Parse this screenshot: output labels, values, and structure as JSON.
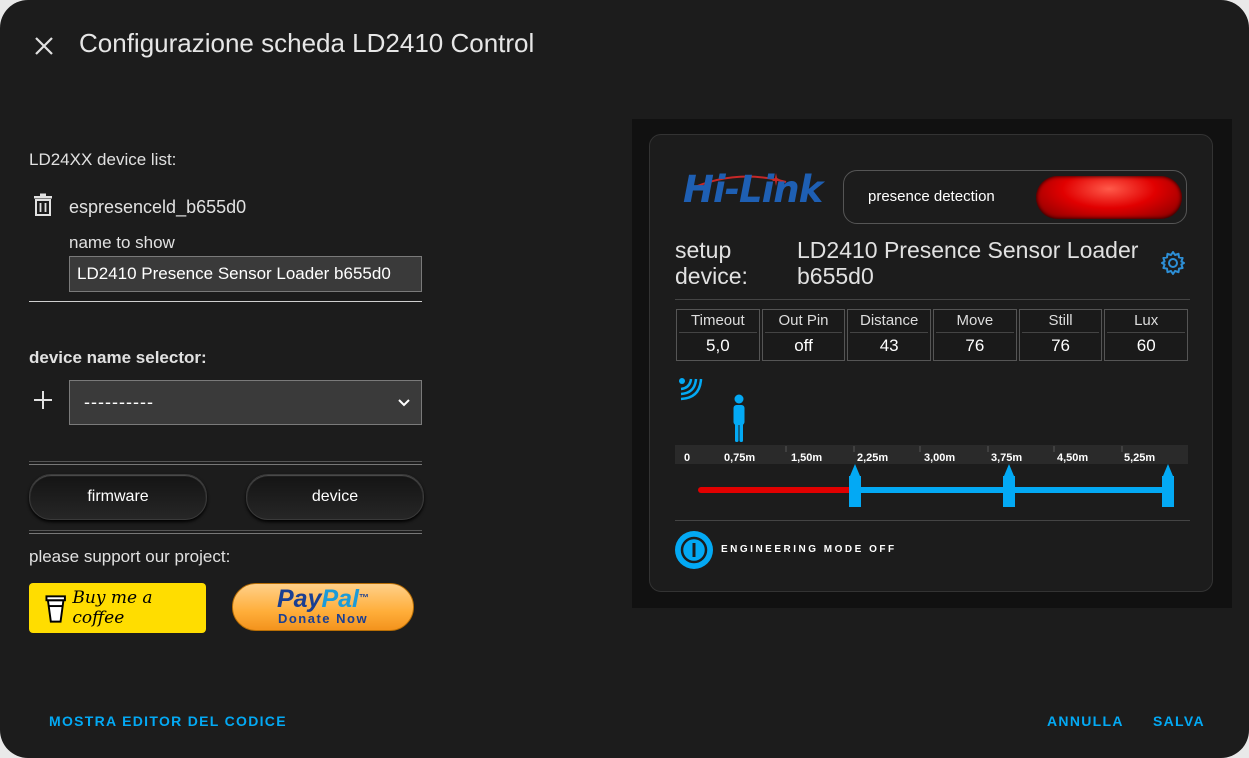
{
  "dialog": {
    "title": "Configurazione scheda LD2410 Control"
  },
  "form": {
    "device_list_label": "LD24XX device list:",
    "device_entity": "espresenceld_b655d0",
    "name_to_show_label": "name to show",
    "name_to_show_value": "LD2410 Presence Sensor Loader b655d0",
    "device_name_selector_label": "device name selector:",
    "selector_value": "----------",
    "firmware_label": "firmware",
    "device_label": "device",
    "support_label": "please support our project:",
    "bmc_label": "Buy me a coffee",
    "paypal_line1a": "Pay",
    "paypal_line1b": "Pal",
    "paypal_tm": "™",
    "paypal_line2": "Donate Now"
  },
  "preview": {
    "brand": "Hi-Link",
    "presence_label": "presence detection",
    "setup_label_1": "setup",
    "setup_label_2": "device:",
    "device_name": "LD2410 Presence Sensor Loader b655d0",
    "stats": [
      {
        "label": "Timeout",
        "value": "5,0"
      },
      {
        "label": "Out Pin",
        "value": "off"
      },
      {
        "label": "Distance",
        "value": "43"
      },
      {
        "label": "Move",
        "value": "76"
      },
      {
        "label": "Still",
        "value": "76"
      },
      {
        "label": "Lux",
        "value": "60"
      }
    ],
    "ruler_ticks": [
      "0",
      "0,75m",
      "1,50m",
      "2,25m",
      "3,00m",
      "3,75m",
      "4,50m",
      "5,25m"
    ],
    "engineering_label": "ENGINEERING MODE OFF",
    "colors": {
      "accent": "#03a9f4",
      "alert": "#e10000"
    }
  },
  "footer": {
    "code_editor": "MOSTRA EDITOR DEL CODICE",
    "cancel": "ANNULLA",
    "save": "SALVA"
  }
}
